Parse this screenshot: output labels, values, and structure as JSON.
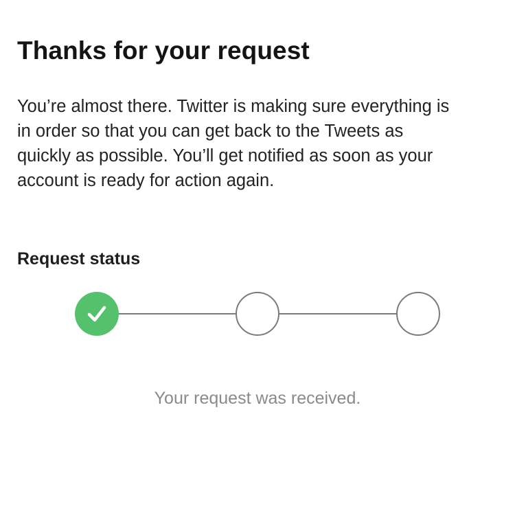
{
  "header": {
    "title": "Thanks for your request"
  },
  "intro": {
    "lines": [
      "You’re almost there. Twitter is making sure everything is",
      "in order so that you can get back to the Tweets as",
      "quickly as possible. You’ll get notified as soon as your",
      "account is ready for action again."
    ]
  },
  "status": {
    "heading": "Request status",
    "steps_completed": 1,
    "steps_total": 3,
    "steps": [
      {
        "state": "complete",
        "icon": "checkmark-icon"
      },
      {
        "state": "pending"
      },
      {
        "state": "pending"
      }
    ],
    "message": "Your request was received."
  },
  "colors": {
    "complete": "#56c16d",
    "pending_outline": "#7a7a7a",
    "message_text": "#8a8a8a"
  }
}
